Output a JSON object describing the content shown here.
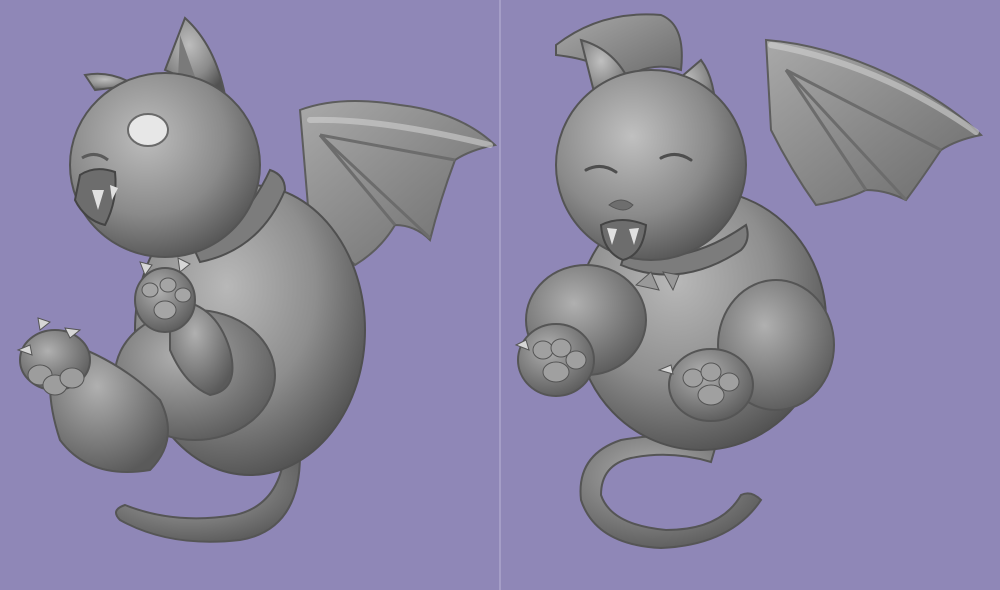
{
  "scene": {
    "background_color": "#8f87b7",
    "divider_color": "#a59ec7",
    "model_color": "#8a8a8a",
    "views": [
      {
        "id": "left",
        "subject": "winged-cat-model-side-view"
      },
      {
        "id": "right",
        "subject": "winged-cat-model-front-view"
      }
    ]
  }
}
